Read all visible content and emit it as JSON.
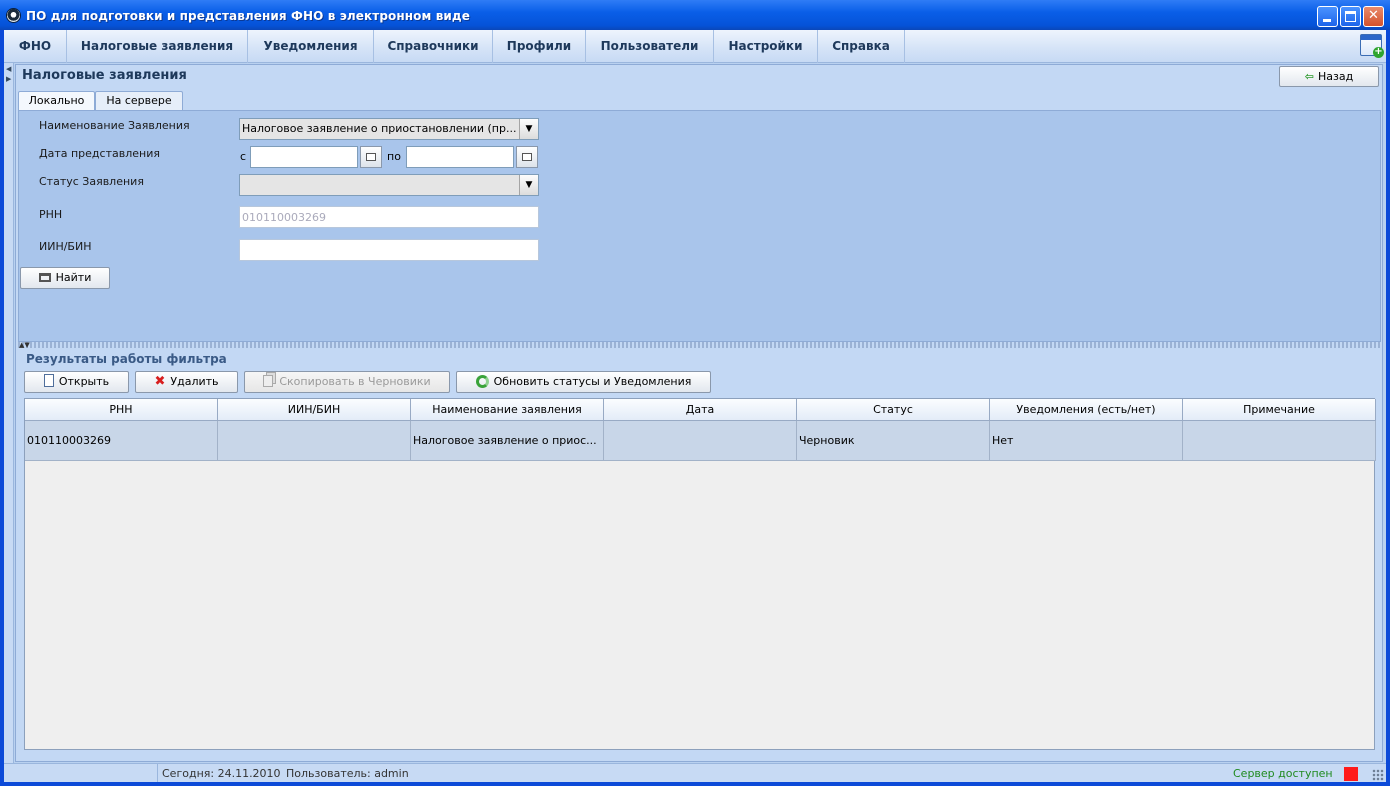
{
  "window": {
    "title": "ПО для подготовки и представления ФНО в электронном виде"
  },
  "menu": {
    "items": [
      {
        "label": "ФНО"
      },
      {
        "label": "Налоговые заявления"
      },
      {
        "label": "Уведомления"
      },
      {
        "label": "Справочники"
      },
      {
        "label": "Профили"
      },
      {
        "label": "Пользователи"
      },
      {
        "label": "Настройки"
      },
      {
        "label": "Справка"
      }
    ]
  },
  "panel": {
    "title": "Налоговые заявления",
    "back_label": "Назад"
  },
  "tabs": [
    {
      "label": "Локально",
      "active": true
    },
    {
      "label": "На сервере",
      "active": false
    }
  ],
  "filter": {
    "statement_name_label": "Наименование Заявления",
    "statement_name_value": "Налоговое заявление о приостановлении (пр...",
    "date_label": "Дата представления",
    "date_from_label": "с",
    "date_to_label": "по",
    "date_from_value": "",
    "date_to_value": "",
    "status_label": "Статус Заявления",
    "status_value": "",
    "rnn_label": "РНН",
    "rnn_value": "010110003269",
    "iin_label": "ИИН/БИН",
    "iin_value": "",
    "find_label": "Найти"
  },
  "results": {
    "title": "Результаты работы фильтра",
    "toolbar": {
      "open_label": "Открыть",
      "delete_label": "Удалить",
      "copy_label": "Скопировать в Черновики",
      "refresh_label": "Обновить статусы и Уведомления"
    },
    "columns": [
      "РНН",
      "ИИН/БИН",
      "Наименование заявления",
      "Дата",
      "Статус",
      "Уведомления (есть/нет)",
      "Примечание"
    ],
    "rows": [
      [
        "010110003269",
        "",
        "Налоговое заявление о приос...",
        "",
        "Черновик",
        "Нет",
        ""
      ]
    ]
  },
  "status": {
    "today": "Сегодня: 24.11.2010",
    "user": "Пользователь: admin",
    "server": "Сервер доступен"
  },
  "colors": {
    "title_blue": "#0a5fe8",
    "server_ok": "#1f8a1f",
    "indicator": "#ff1a1a"
  }
}
